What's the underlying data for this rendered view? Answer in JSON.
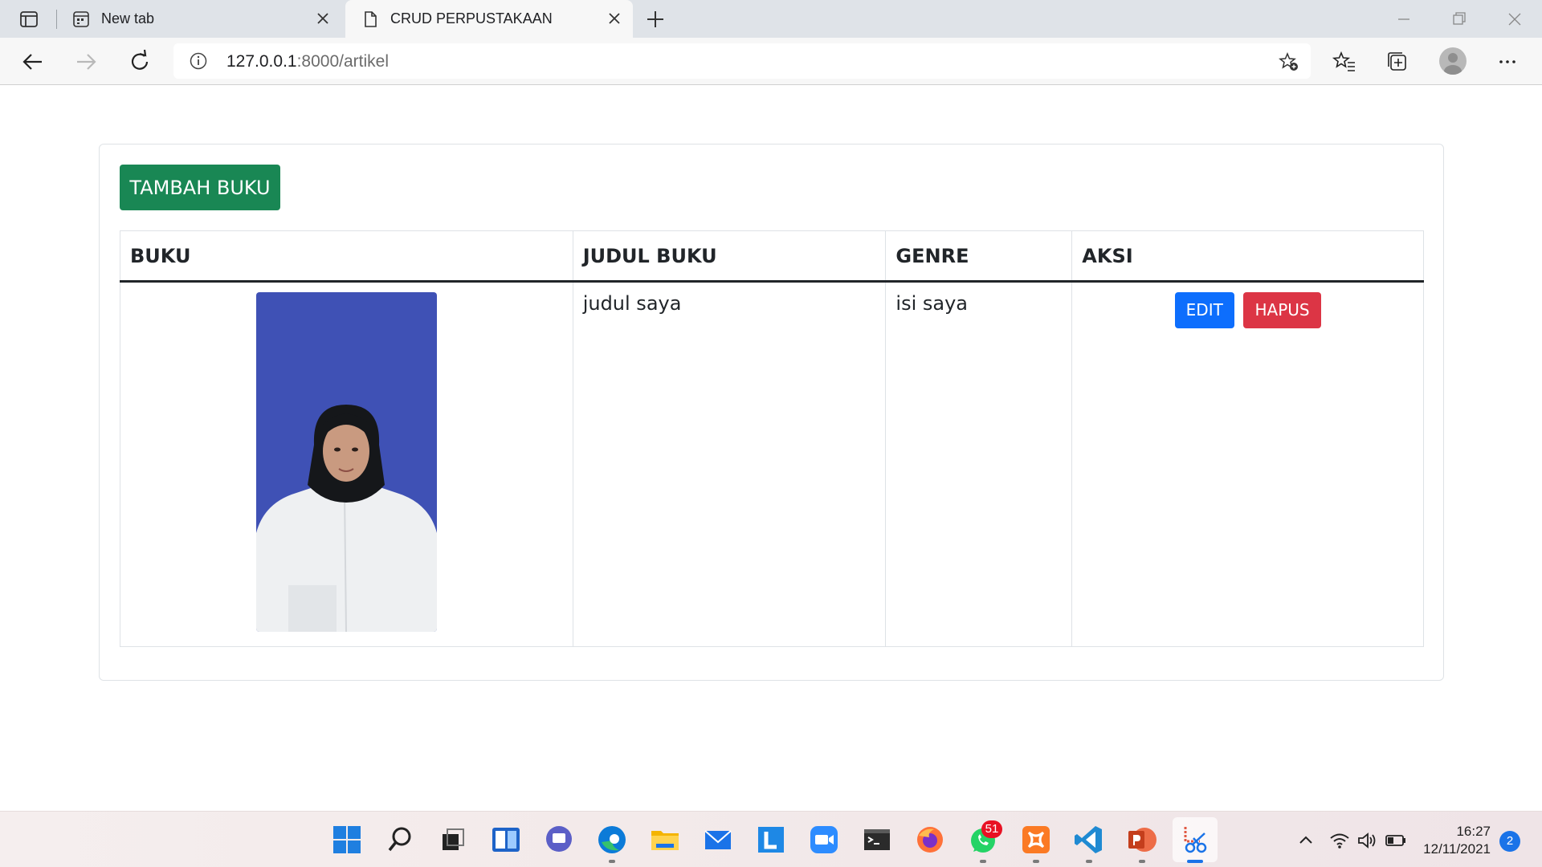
{
  "browser": {
    "tabs": [
      {
        "title": "New tab",
        "icon": "new-tab-page-icon",
        "active": false
      },
      {
        "title": "CRUD PERPUSTAKAAN",
        "icon": "page-icon",
        "active": true
      }
    ],
    "url_host": "127.0.0.1",
    "url_rest": ":8000/artikel"
  },
  "page": {
    "add_button_label": "TAMBAH BUKU",
    "table": {
      "headers": [
        "BUKU",
        "JUDUL BUKU",
        "GENRE",
        "AKSI"
      ],
      "rows": [
        {
          "image": "book-cover-photo",
          "judul": "judul saya",
          "genre": "isi saya",
          "edit_label": "EDIT",
          "delete_label": "HAPUS"
        }
      ]
    }
  },
  "colors": {
    "success": "#198754",
    "primary": "#0d6efd",
    "danger": "#dc3545",
    "photo_bg": "#3f51b5"
  },
  "taskbar": {
    "icons": [
      "windows-start-icon",
      "search-icon",
      "task-view-icon",
      "widgets-icon",
      "teams-chat-icon",
      "edge-icon",
      "file-explorer-icon",
      "mail-icon",
      "l-app-icon",
      "zoom-icon",
      "terminal-icon",
      "firefox-icon",
      "whatsapp-icon",
      "xampp-icon",
      "vscode-icon",
      "powerpoint-icon",
      "snipping-tool-icon"
    ],
    "whatsapp_badge": "51",
    "time": "16:27",
    "date": "12/11/2021",
    "notification_count": "2"
  }
}
